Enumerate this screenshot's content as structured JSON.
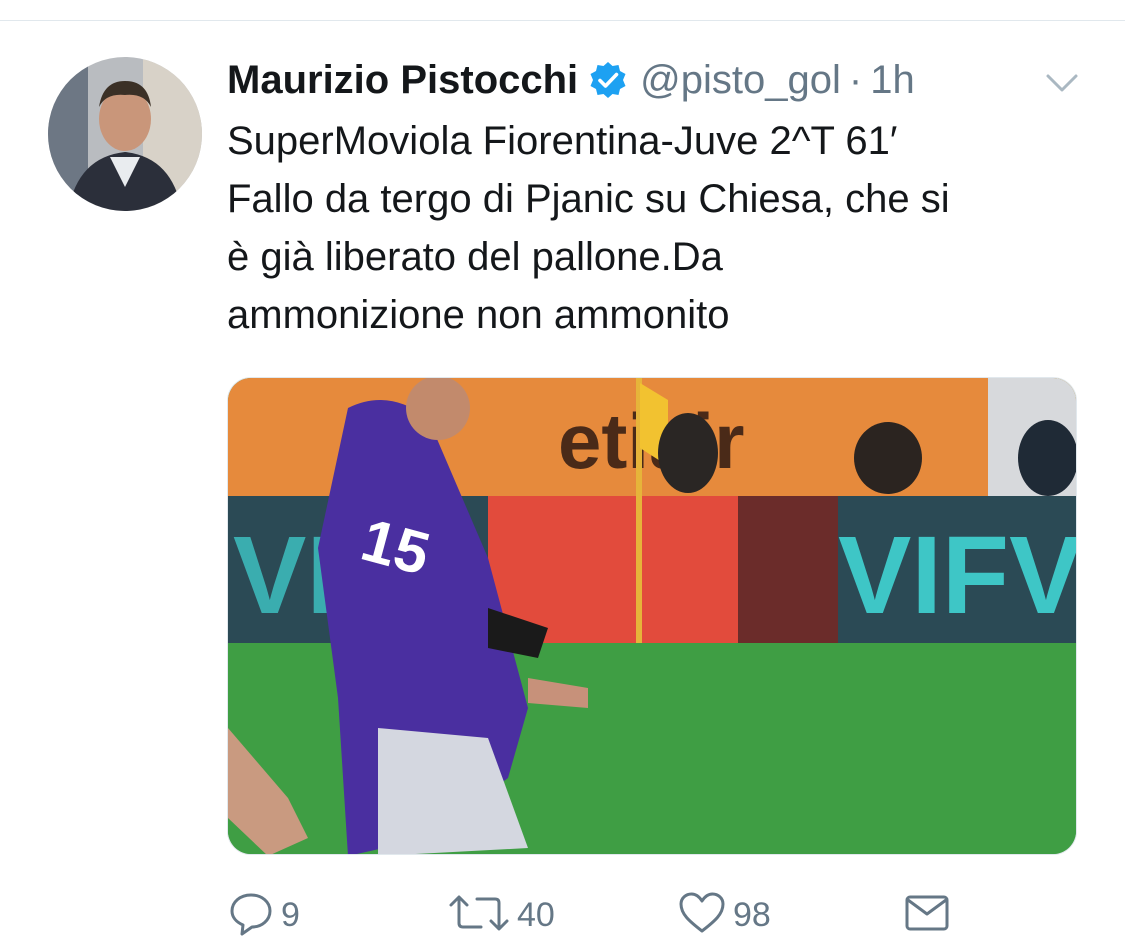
{
  "tweet": {
    "author_name": "Maurizio Pistocchi",
    "author_handle": "@pisto_gol",
    "separator": "·",
    "time": "1h",
    "text": "SuperMoviola Fiorentina-Juve 2^T 61′\nFallo da tergo di Pjanic su Chiesa, che si\nè già liberato del pallone.Da\nammonizione non ammonito"
  },
  "media": {
    "stadium_board_text": "etiair",
    "ad_board_text": "VIFV"
  },
  "actions": {
    "reply_count": "9",
    "retweet_count": "40",
    "like_count": "98"
  },
  "icons": {
    "verified": "verified-badge-icon",
    "chevron": "chevron-down-icon",
    "reply": "reply-icon",
    "retweet": "retweet-icon",
    "like": "heart-icon",
    "dm": "envelope-icon"
  },
  "colors": {
    "verified_blue": "#1da1f2",
    "muted_text": "#657786",
    "text": "#14171a"
  }
}
